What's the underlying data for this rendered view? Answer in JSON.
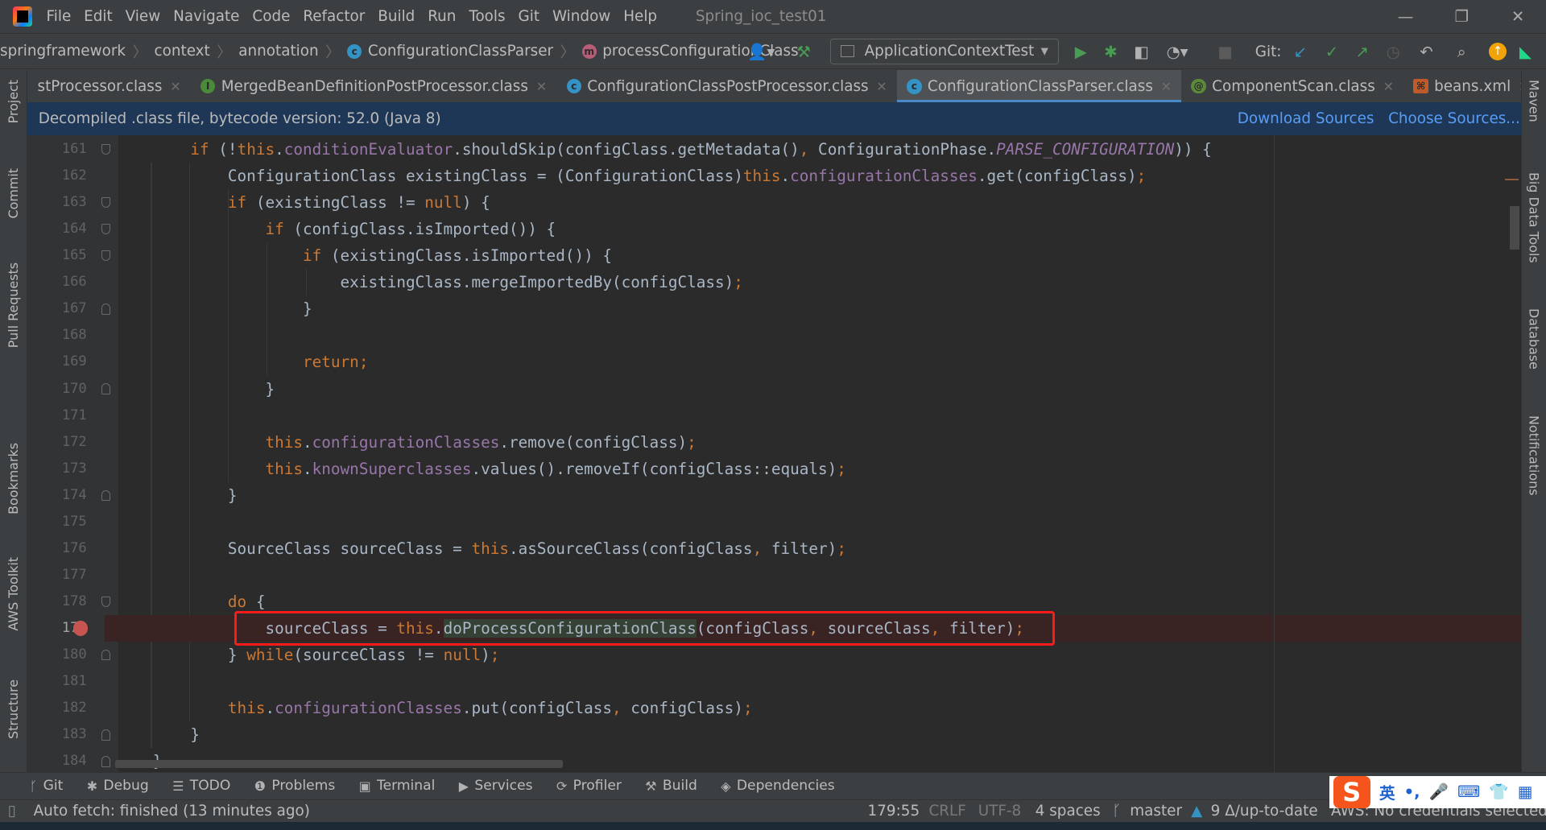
{
  "window": {
    "title": "Spring_ioc_test01",
    "minimize": "—",
    "restore": "❐",
    "close": "✕"
  },
  "menu": [
    "File",
    "Edit",
    "View",
    "Navigate",
    "Code",
    "Refactor",
    "Build",
    "Run",
    "Tools",
    "Git",
    "Window",
    "Help"
  ],
  "breadcrumb": [
    {
      "label": "springframework"
    },
    {
      "label": "context"
    },
    {
      "label": "annotation"
    },
    {
      "label": "ConfigurationClassParser",
      "icon": "c"
    },
    {
      "label": "processConfigurationClass",
      "icon": "m"
    }
  ],
  "toolbar": {
    "run_config": "ApplicationContextTest",
    "git_label": "Git:"
  },
  "tabs": [
    {
      "label": "stProcessor.class",
      "icon": ""
    },
    {
      "label": "MergedBeanDefinitionPostProcessor.class",
      "icon": "I"
    },
    {
      "label": "ConfigurationClassPostProcessor.class",
      "icon": "c"
    },
    {
      "label": "ConfigurationClassParser.class",
      "icon": "c",
      "active": true
    },
    {
      "label": "ComponentScan.class",
      "icon": "@"
    },
    {
      "label": "beans.xml",
      "icon": "xml"
    }
  ],
  "banner": {
    "text": "Decompiled .class file, bytecode version: 52.0 (Java 8)",
    "download": "Download Sources",
    "choose": "Choose Sources..."
  },
  "left_stripe": [
    "Project",
    "Commit",
    "Pull Requests",
    "Bookmarks",
    "AWS Toolkit",
    "Structure"
  ],
  "right_stripe": [
    "Maven",
    "Big Data Tools",
    "Database",
    "Notifications"
  ],
  "editor": {
    "current_line": 179,
    "breakpoint_line": 179,
    "lines": [
      {
        "n": 161,
        "fold": "open",
        "t": [
          [
            "        ",
            ""
          ],
          [
            "if",
            "kw"
          ],
          [
            " (!",
            ""
          ],
          [
            "this",
            "kw"
          ],
          [
            ".",
            ""
          ],
          [
            "conditionEvaluator",
            "fld"
          ],
          [
            ".shouldSkip(configClass.getMetadata()",
            ""
          ],
          [
            ",",
            "pun"
          ],
          [
            " ConfigurationPhase.",
            ""
          ],
          [
            "PARSE_CONFIGURATION",
            "sfld"
          ],
          [
            ")) {",
            ""
          ]
        ]
      },
      {
        "n": 162,
        "t": [
          [
            "            ConfigurationClass existingClass = (ConfigurationClass)",
            ""
          ],
          [
            "this",
            "kw"
          ],
          [
            ".",
            ""
          ],
          [
            "configurationClasses",
            "fld"
          ],
          [
            ".get(configClass)",
            ""
          ],
          [
            ";",
            "pun"
          ]
        ]
      },
      {
        "n": 163,
        "fold": "open",
        "t": [
          [
            "            ",
            ""
          ],
          [
            "if",
            "kw"
          ],
          [
            " (existingClass != ",
            ""
          ],
          [
            "null",
            "kw"
          ],
          [
            ") {",
            ""
          ]
        ]
      },
      {
        "n": 164,
        "fold": "open",
        "t": [
          [
            "                ",
            ""
          ],
          [
            "if",
            "kw"
          ],
          [
            " (configClass.isImported()) {",
            ""
          ]
        ]
      },
      {
        "n": 165,
        "fold": "open",
        "t": [
          [
            "                    ",
            ""
          ],
          [
            "if",
            "kw"
          ],
          [
            " (existingClass.isImported()) {",
            ""
          ]
        ]
      },
      {
        "n": 166,
        "t": [
          [
            "                        existingClass.mergeImportedBy(configClass)",
            ""
          ],
          [
            ";",
            "pun"
          ]
        ]
      },
      {
        "n": 167,
        "fold": "close",
        "t": [
          [
            "                    }",
            ""
          ]
        ]
      },
      {
        "n": 168,
        "t": []
      },
      {
        "n": 169,
        "t": [
          [
            "                    ",
            ""
          ],
          [
            "return;",
            "kw"
          ]
        ]
      },
      {
        "n": 170,
        "fold": "close",
        "t": [
          [
            "                }",
            ""
          ]
        ]
      },
      {
        "n": 171,
        "t": []
      },
      {
        "n": 172,
        "t": [
          [
            "                ",
            ""
          ],
          [
            "this",
            "kw"
          ],
          [
            ".",
            ""
          ],
          [
            "configurationClasses",
            "fld"
          ],
          [
            ".remove(configClass)",
            ""
          ],
          [
            ";",
            "pun"
          ]
        ]
      },
      {
        "n": 173,
        "t": [
          [
            "                ",
            ""
          ],
          [
            "this",
            "kw"
          ],
          [
            ".",
            ""
          ],
          [
            "knownSuperclasses",
            "fld"
          ],
          [
            ".values().removeIf(configClass::equals)",
            ""
          ],
          [
            ";",
            "pun"
          ]
        ]
      },
      {
        "n": 174,
        "fold": "close",
        "t": [
          [
            "            }",
            ""
          ]
        ]
      },
      {
        "n": 175,
        "t": []
      },
      {
        "n": 176,
        "t": [
          [
            "            SourceClass sourceClass = ",
            ""
          ],
          [
            "this",
            "kw"
          ],
          [
            ".asSourceClass(configClass",
            ""
          ],
          [
            ",",
            "pun"
          ],
          [
            " filter)",
            ""
          ],
          [
            ";",
            "pun"
          ]
        ]
      },
      {
        "n": 177,
        "t": []
      },
      {
        "n": 178,
        "fold": "open",
        "t": [
          [
            "            ",
            ""
          ],
          [
            "do",
            "kw"
          ],
          [
            " {",
            ""
          ]
        ]
      },
      {
        "n": 179,
        "t": [
          [
            "                sourceClass = ",
            ""
          ],
          [
            "this",
            "kw"
          ],
          [
            ".",
            ""
          ],
          [
            "doProcessConfigurationClass",
            "hl"
          ],
          [
            "(configClass",
            ""
          ],
          [
            ",",
            "pun"
          ],
          [
            " sourceClass",
            ""
          ],
          [
            ",",
            "pun"
          ],
          [
            " filter)",
            ""
          ],
          [
            ";",
            "pun"
          ]
        ]
      },
      {
        "n": 180,
        "fold": "close",
        "t": [
          [
            "            } ",
            ""
          ],
          [
            "while",
            "kw"
          ],
          [
            "(sourceClass != ",
            ""
          ],
          [
            "null",
            "kw"
          ],
          [
            ")",
            ""
          ],
          [
            ";",
            "pun"
          ]
        ]
      },
      {
        "n": 181,
        "t": []
      },
      {
        "n": 182,
        "t": [
          [
            "            ",
            ""
          ],
          [
            "this",
            "kw"
          ],
          [
            ".",
            ""
          ],
          [
            "configurationClasses",
            "fld"
          ],
          [
            ".put(configClass",
            ""
          ],
          [
            ",",
            "pun"
          ],
          [
            " configClass)",
            ""
          ],
          [
            ";",
            "pun"
          ]
        ]
      },
      {
        "n": 183,
        "fold": "close",
        "t": [
          [
            "        }",
            ""
          ]
        ]
      },
      {
        "n": 184,
        "fold": "close",
        "t": [
          [
            "    }",
            ""
          ]
        ]
      }
    ]
  },
  "tool_windows": [
    {
      "icon": "ᚴ",
      "label": "Git"
    },
    {
      "icon": "✱",
      "label": "Debug"
    },
    {
      "icon": "☰",
      "label": "TODO"
    },
    {
      "icon": "❶",
      "label": "Problems"
    },
    {
      "icon": "▣",
      "label": "Terminal"
    },
    {
      "icon": "▶",
      "label": "Services"
    },
    {
      "icon": "⟳",
      "label": "Profiler"
    },
    {
      "icon": "⚒",
      "label": "Build"
    },
    {
      "icon": "◈",
      "label": "Dependencies"
    }
  ],
  "status": {
    "message": "Auto fetch: finished (13 minutes ago)",
    "position": "179:55",
    "line_sep": "CRLF",
    "encoding": "UTF-8",
    "indent": "4 spaces",
    "branch": "master",
    "vcs": "9 Δ/up-to-date",
    "aws": "AWS: No credentials selected"
  },
  "ime": {
    "logo": "S",
    "lang": "英",
    "items": [
      "•,",
      "🎤",
      "⌨",
      "👕",
      "▦"
    ]
  },
  "colors": {
    "keyword": "#cc7832",
    "field": "#9876aa",
    "text": "#a9b7c6",
    "breakpoint": "#c75450",
    "highlight_box": "#ff1a1a",
    "link": "#589df6"
  }
}
